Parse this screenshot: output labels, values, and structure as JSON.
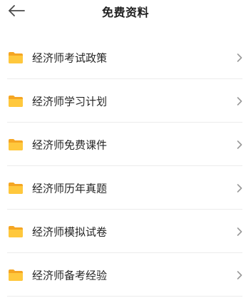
{
  "header": {
    "title": "免费资料",
    "back_icon": "arrow-left-icon"
  },
  "list": {
    "items": [
      {
        "label": "经济师考试政策",
        "icon": "folder-icon"
      },
      {
        "label": "经济师学习计划",
        "icon": "folder-icon"
      },
      {
        "label": "经济师免费课件",
        "icon": "folder-icon"
      },
      {
        "label": "经济师历年真题",
        "icon": "folder-icon"
      },
      {
        "label": "经济师模拟试卷",
        "icon": "folder-icon"
      },
      {
        "label": "经济师备考经验",
        "icon": "folder-icon"
      }
    ]
  },
  "colors": {
    "folder_back": "#F5A623",
    "folder_front": "#FFC83D",
    "chevron": "#9a9a9a",
    "divider": "#ececec"
  }
}
